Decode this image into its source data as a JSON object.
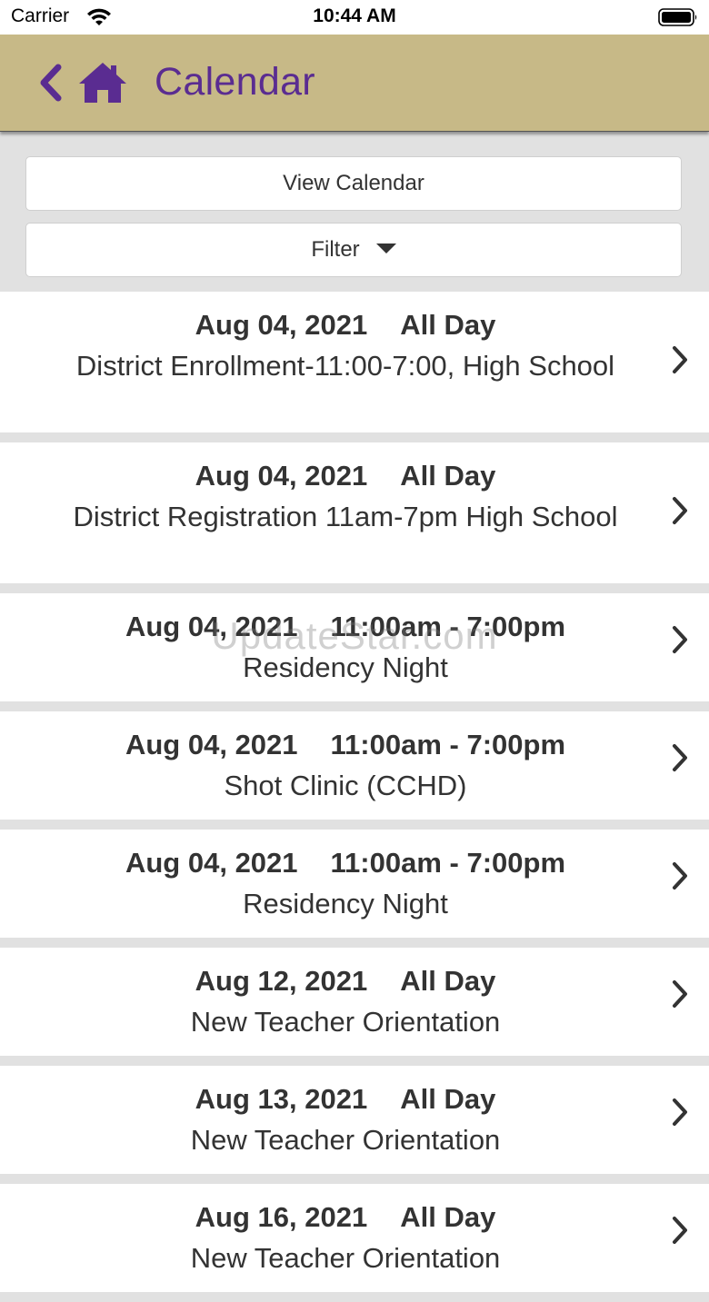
{
  "status_bar": {
    "carrier": "Carrier",
    "time": "10:44 AM"
  },
  "header": {
    "title": "Calendar",
    "back_icon": "chevron-left-icon",
    "home_icon": "home-icon",
    "background_color": "#c7b987",
    "accent_color": "#5a2c91"
  },
  "controls": {
    "view_calendar_label": "View Calendar",
    "filter_label": "Filter"
  },
  "events": [
    {
      "date": "Aug 04, 2021",
      "time": "All Day",
      "title": "District Enrollment-11:00-7:00, High School"
    },
    {
      "date": "Aug 04, 2021",
      "time": "All Day",
      "title": "District Registration 11am-7pm High School"
    },
    {
      "date": "Aug 04, 2021",
      "time": "11:00am - 7:00pm",
      "title": "Residency Night"
    },
    {
      "date": "Aug 04, 2021",
      "time": "11:00am - 7:00pm",
      "title": "Shot Clinic (CCHD)"
    },
    {
      "date": "Aug 04, 2021",
      "time": "11:00am - 7:00pm",
      "title": "Residency Night"
    },
    {
      "date": "Aug 12, 2021",
      "time": "All Day",
      "title": "New Teacher Orientation"
    },
    {
      "date": "Aug 13, 2021",
      "time": "All Day",
      "title": "New Teacher Orientation"
    },
    {
      "date": "Aug 16, 2021",
      "time": "All Day",
      "title": "New Teacher Orientation"
    }
  ],
  "watermark": "UpdateStar.com"
}
